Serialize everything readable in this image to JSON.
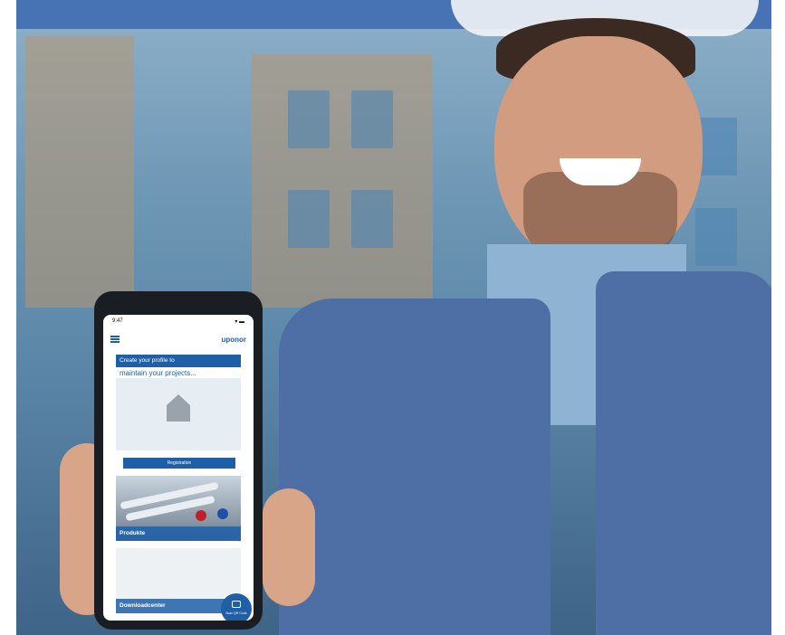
{
  "phone": {
    "status_time": "9:47",
    "status_icons": "▾ ▬",
    "logo": "uponor",
    "profile_title": "Create your profile to",
    "profile_subtitle": "maintain your projects...",
    "registration_button": "Registration",
    "products_label": "Produkte",
    "download_label": "Downloadcenter",
    "qr_button_label": "Scan QR Code"
  },
  "colors": {
    "brand_blue": "#1f5fa8",
    "vest_blue": "#4e6fa6"
  }
}
